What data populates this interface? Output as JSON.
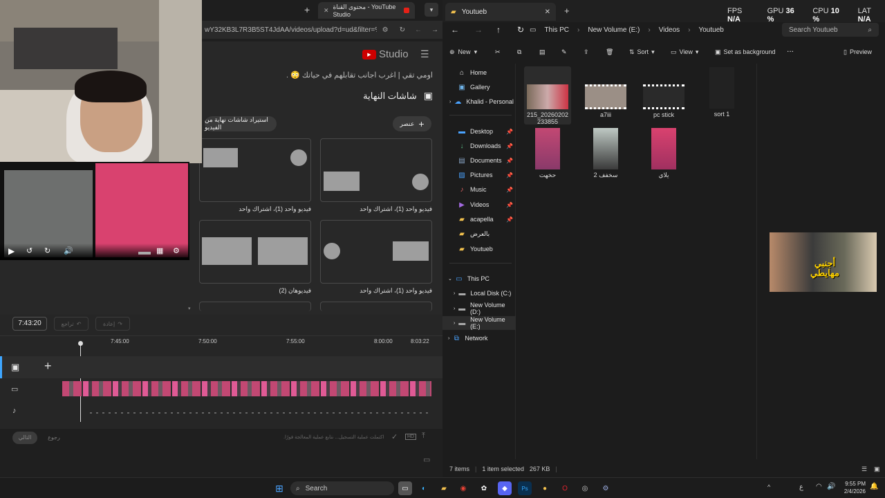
{
  "browser": {
    "tab_title": "محتوى القناة - YouTube Studio",
    "url": "wY32KB3L7R3B5ST4JdAA/videos/upload?d=ud&filter=%...",
    "studio_logo": "Studio",
    "banner_text": "اومي تقي | اغرب اجانب تقابلهم في حياتك 😳 ."
  },
  "endscreen": {
    "title": "شاشات النهاية",
    "import_label": "استيراد شاشات نهاية من الفيديو",
    "element_label": "عنصر",
    "templates": [
      {
        "caption": "فيديو واحد (1)، اشتراك واحد"
      },
      {
        "caption": "فيديو واحد (1)، اشتراك واحد"
      },
      {
        "caption": "فيديو واحد (1)، اشتراك واحد"
      },
      {
        "caption": "فيديوهان (2)"
      }
    ]
  },
  "timeline": {
    "time": "7:43:20",
    "undo_label": "تراجع",
    "redo_label": "إعادة",
    "ticks": [
      "7:45:00",
      "7:50:00",
      "7:55:00",
      "8:00:00",
      "8:03:22"
    ]
  },
  "footer": {
    "status": "اكتملت عملية التسجيل... نتابع عملية المعالجة فورًا.",
    "back": "رجوع",
    "next": "التالي"
  },
  "stats": {
    "fps_label": "FPS",
    "fps": "N/A",
    "gpu_label": "GPU",
    "gpu": "36 %",
    "cpu_label": "CPU",
    "cpu": "10 %",
    "lat_label": "LAT",
    "lat": "N/A"
  },
  "explorer": {
    "tab_title": "Youtueb",
    "breadcrumb": [
      "This PC",
      "New Volume (E:)",
      "Videos",
      "Youtueb"
    ],
    "search_placeholder": "Search Youtueb",
    "commands": {
      "new": "New",
      "sort": "Sort",
      "view": "View",
      "background": "Set as background",
      "more": "...",
      "preview": "Preview"
    },
    "nav": {
      "home": "Home",
      "gallery": "Gallery",
      "onedrive": "Khalid - Personal",
      "desktop": "Desktop",
      "downloads": "Downloads",
      "documents": "Documents",
      "pictures": "Pictures",
      "music": "Music",
      "videos": "Videos",
      "acapella": "acapella",
      "bil3ard": "بالعرض",
      "youtueb": "Youtueb",
      "thispc": "This PC",
      "c": "Local Disk (C:)",
      "d": "New Volume (D:)",
      "e": "New Volume (E:)",
      "network": "Network"
    },
    "files": [
      {
        "name": "215_20260202233855"
      },
      {
        "name": "a7iii"
      },
      {
        "name": "pc stick"
      },
      {
        "name": "sort 1"
      },
      {
        "name": "حخهت"
      },
      {
        "name": "سخفف 2"
      },
      {
        "name": "يلاي"
      }
    ],
    "status": {
      "items": "7 items",
      "selected": "1 item selected",
      "size": "267 KB"
    }
  },
  "taskbar": {
    "search": "Search",
    "tray_lang": "ع",
    "time": "9:55 PM",
    "date": "2/4/2026"
  },
  "overlay_thumb_text": "أجنبي مهايطي"
}
